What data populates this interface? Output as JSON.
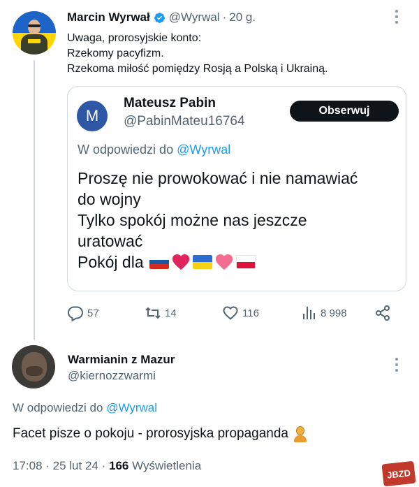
{
  "colors": {
    "accent": "#1d9bf0",
    "text": "#0f1419",
    "muted": "#536471",
    "border": "#cfd9de",
    "like_heart": "#e0245e"
  },
  "tweet": {
    "author_name": "Marcin Wyrwał",
    "handle": "@Wyrwal",
    "dot": "·",
    "time": "20 g.",
    "lines": [
      "Uwaga, prorosyjskie konto:",
      "Rzekomy pacyfizm.",
      "Rzekoma miłość pomiędzy Rosją a Polską i Ukrainą."
    ]
  },
  "quote": {
    "avatar_letter": "M",
    "author_name": "Mateusz Pabin",
    "handle": "@PabinMateu16764",
    "follow_label": "Obserwuj",
    "reply_prefix": "W odpowiedzi do",
    "reply_mention": "@Wyrwal",
    "lines": [
      "Proszę nie prowokować i nie namawiać",
      "do wojny",
      "Tylko spokój możne nas jeszcze",
      "uratować"
    ],
    "last_line_text": "Pokój dla",
    "last_line_emojis": [
      "russia-flag",
      "red-heart",
      "ukraine-flag",
      "pink-heart",
      "poland-flag"
    ]
  },
  "actions": {
    "replies": "57",
    "retweets": "14",
    "likes": "116",
    "views": "8 998"
  },
  "reply_tweet": {
    "author_name": "Warmianin z Mazur",
    "handle": "@kiernozzwarmi",
    "reply_prefix": "W odpowiedzi do",
    "reply_mention": "@Wyrwal",
    "text": "Facet pisze o pokoju - prorosyjska propaganda",
    "emoji": "person-pouting",
    "time": "17:08 · 25 lut 24 ·",
    "views_count": "166",
    "views_label": "Wyświetlenia"
  },
  "watermark": "JBZD"
}
